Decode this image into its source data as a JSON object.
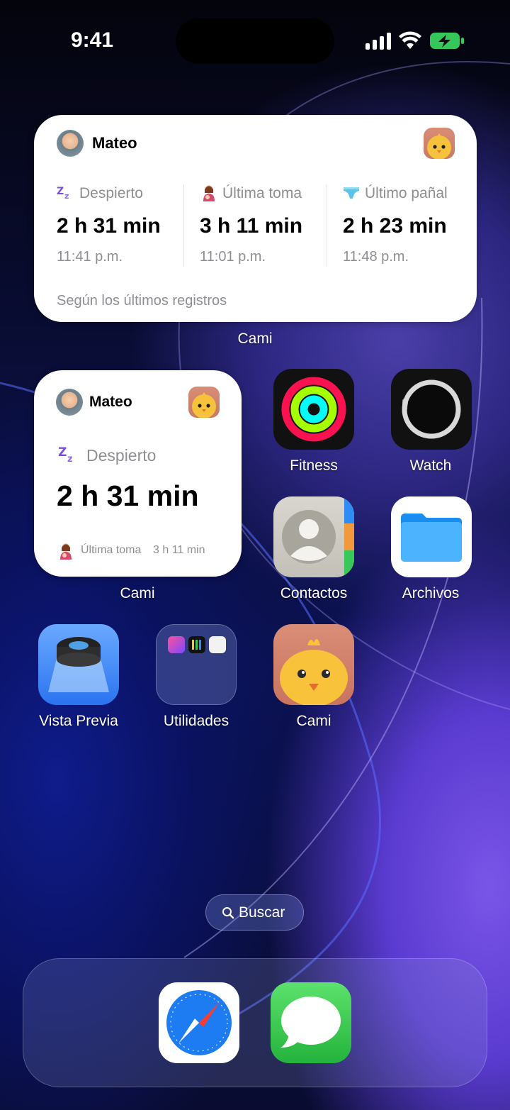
{
  "status": {
    "time": "9:41"
  },
  "widget_large": {
    "child_name": "Mateo",
    "columns": [
      {
        "label": "Despierto",
        "value": "2 h 31 min",
        "time": "11:41 p.m."
      },
      {
        "label": "Última toma",
        "value": "3 h 11 min",
        "time": "11:01 p.m."
      },
      {
        "label": "Último pañal",
        "value": "2 h 23 min",
        "time": "11:48 p.m."
      }
    ],
    "footer": "Según los últimos registros",
    "app_label": "Cami"
  },
  "widget_small": {
    "child_name": "Mateo",
    "status_label": "Despierto",
    "value": "2 h 31 min",
    "last_feed_label": "Última toma",
    "last_feed_value": "3 h 11 min",
    "app_label": "Cami"
  },
  "apps": {
    "fitness": "Fitness",
    "watch": "Watch",
    "contactos": "Contactos",
    "archivos": "Archivos",
    "vista_previa": "Vista Previa",
    "utilidades": "Utilidades",
    "cami": "Cami"
  },
  "search": {
    "label": "Buscar"
  },
  "colors": {
    "accent_zz": "#7b4fd6",
    "messages_green": "#35c759",
    "safari_blue": "#1e7cf2"
  }
}
